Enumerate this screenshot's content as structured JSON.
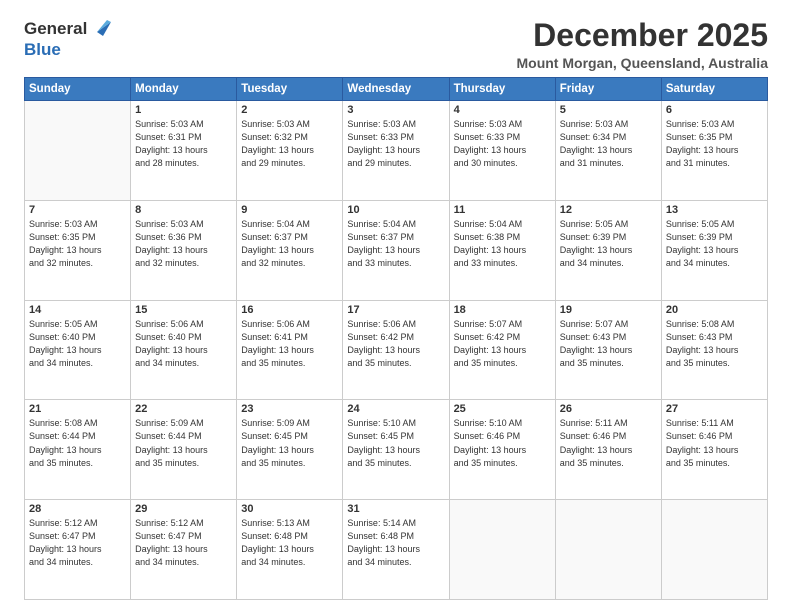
{
  "header": {
    "logo_general": "General",
    "logo_blue": "Blue",
    "month": "December 2025",
    "location": "Mount Morgan, Queensland, Australia"
  },
  "weekdays": [
    "Sunday",
    "Monday",
    "Tuesday",
    "Wednesday",
    "Thursday",
    "Friday",
    "Saturday"
  ],
  "weeks": [
    [
      {
        "day": "",
        "info": ""
      },
      {
        "day": "1",
        "info": "Sunrise: 5:03 AM\nSunset: 6:31 PM\nDaylight: 13 hours\nand 28 minutes."
      },
      {
        "day": "2",
        "info": "Sunrise: 5:03 AM\nSunset: 6:32 PM\nDaylight: 13 hours\nand 29 minutes."
      },
      {
        "day": "3",
        "info": "Sunrise: 5:03 AM\nSunset: 6:33 PM\nDaylight: 13 hours\nand 29 minutes."
      },
      {
        "day": "4",
        "info": "Sunrise: 5:03 AM\nSunset: 6:33 PM\nDaylight: 13 hours\nand 30 minutes."
      },
      {
        "day": "5",
        "info": "Sunrise: 5:03 AM\nSunset: 6:34 PM\nDaylight: 13 hours\nand 31 minutes."
      },
      {
        "day": "6",
        "info": "Sunrise: 5:03 AM\nSunset: 6:35 PM\nDaylight: 13 hours\nand 31 minutes."
      }
    ],
    [
      {
        "day": "7",
        "info": "Sunrise: 5:03 AM\nSunset: 6:35 PM\nDaylight: 13 hours\nand 32 minutes."
      },
      {
        "day": "8",
        "info": "Sunrise: 5:03 AM\nSunset: 6:36 PM\nDaylight: 13 hours\nand 32 minutes."
      },
      {
        "day": "9",
        "info": "Sunrise: 5:04 AM\nSunset: 6:37 PM\nDaylight: 13 hours\nand 32 minutes."
      },
      {
        "day": "10",
        "info": "Sunrise: 5:04 AM\nSunset: 6:37 PM\nDaylight: 13 hours\nand 33 minutes."
      },
      {
        "day": "11",
        "info": "Sunrise: 5:04 AM\nSunset: 6:38 PM\nDaylight: 13 hours\nand 33 minutes."
      },
      {
        "day": "12",
        "info": "Sunrise: 5:05 AM\nSunset: 6:39 PM\nDaylight: 13 hours\nand 34 minutes."
      },
      {
        "day": "13",
        "info": "Sunrise: 5:05 AM\nSunset: 6:39 PM\nDaylight: 13 hours\nand 34 minutes."
      }
    ],
    [
      {
        "day": "14",
        "info": "Sunrise: 5:05 AM\nSunset: 6:40 PM\nDaylight: 13 hours\nand 34 minutes."
      },
      {
        "day": "15",
        "info": "Sunrise: 5:06 AM\nSunset: 6:40 PM\nDaylight: 13 hours\nand 34 minutes."
      },
      {
        "day": "16",
        "info": "Sunrise: 5:06 AM\nSunset: 6:41 PM\nDaylight: 13 hours\nand 35 minutes."
      },
      {
        "day": "17",
        "info": "Sunrise: 5:06 AM\nSunset: 6:42 PM\nDaylight: 13 hours\nand 35 minutes."
      },
      {
        "day": "18",
        "info": "Sunrise: 5:07 AM\nSunset: 6:42 PM\nDaylight: 13 hours\nand 35 minutes."
      },
      {
        "day": "19",
        "info": "Sunrise: 5:07 AM\nSunset: 6:43 PM\nDaylight: 13 hours\nand 35 minutes."
      },
      {
        "day": "20",
        "info": "Sunrise: 5:08 AM\nSunset: 6:43 PM\nDaylight: 13 hours\nand 35 minutes."
      }
    ],
    [
      {
        "day": "21",
        "info": "Sunrise: 5:08 AM\nSunset: 6:44 PM\nDaylight: 13 hours\nand 35 minutes."
      },
      {
        "day": "22",
        "info": "Sunrise: 5:09 AM\nSunset: 6:44 PM\nDaylight: 13 hours\nand 35 minutes."
      },
      {
        "day": "23",
        "info": "Sunrise: 5:09 AM\nSunset: 6:45 PM\nDaylight: 13 hours\nand 35 minutes."
      },
      {
        "day": "24",
        "info": "Sunrise: 5:10 AM\nSunset: 6:45 PM\nDaylight: 13 hours\nand 35 minutes."
      },
      {
        "day": "25",
        "info": "Sunrise: 5:10 AM\nSunset: 6:46 PM\nDaylight: 13 hours\nand 35 minutes."
      },
      {
        "day": "26",
        "info": "Sunrise: 5:11 AM\nSunset: 6:46 PM\nDaylight: 13 hours\nand 35 minutes."
      },
      {
        "day": "27",
        "info": "Sunrise: 5:11 AM\nSunset: 6:46 PM\nDaylight: 13 hours\nand 35 minutes."
      }
    ],
    [
      {
        "day": "28",
        "info": "Sunrise: 5:12 AM\nSunset: 6:47 PM\nDaylight: 13 hours\nand 34 minutes."
      },
      {
        "day": "29",
        "info": "Sunrise: 5:12 AM\nSunset: 6:47 PM\nDaylight: 13 hours\nand 34 minutes."
      },
      {
        "day": "30",
        "info": "Sunrise: 5:13 AM\nSunset: 6:48 PM\nDaylight: 13 hours\nand 34 minutes."
      },
      {
        "day": "31",
        "info": "Sunrise: 5:14 AM\nSunset: 6:48 PM\nDaylight: 13 hours\nand 34 minutes."
      },
      {
        "day": "",
        "info": ""
      },
      {
        "day": "",
        "info": ""
      },
      {
        "day": "",
        "info": ""
      }
    ]
  ]
}
